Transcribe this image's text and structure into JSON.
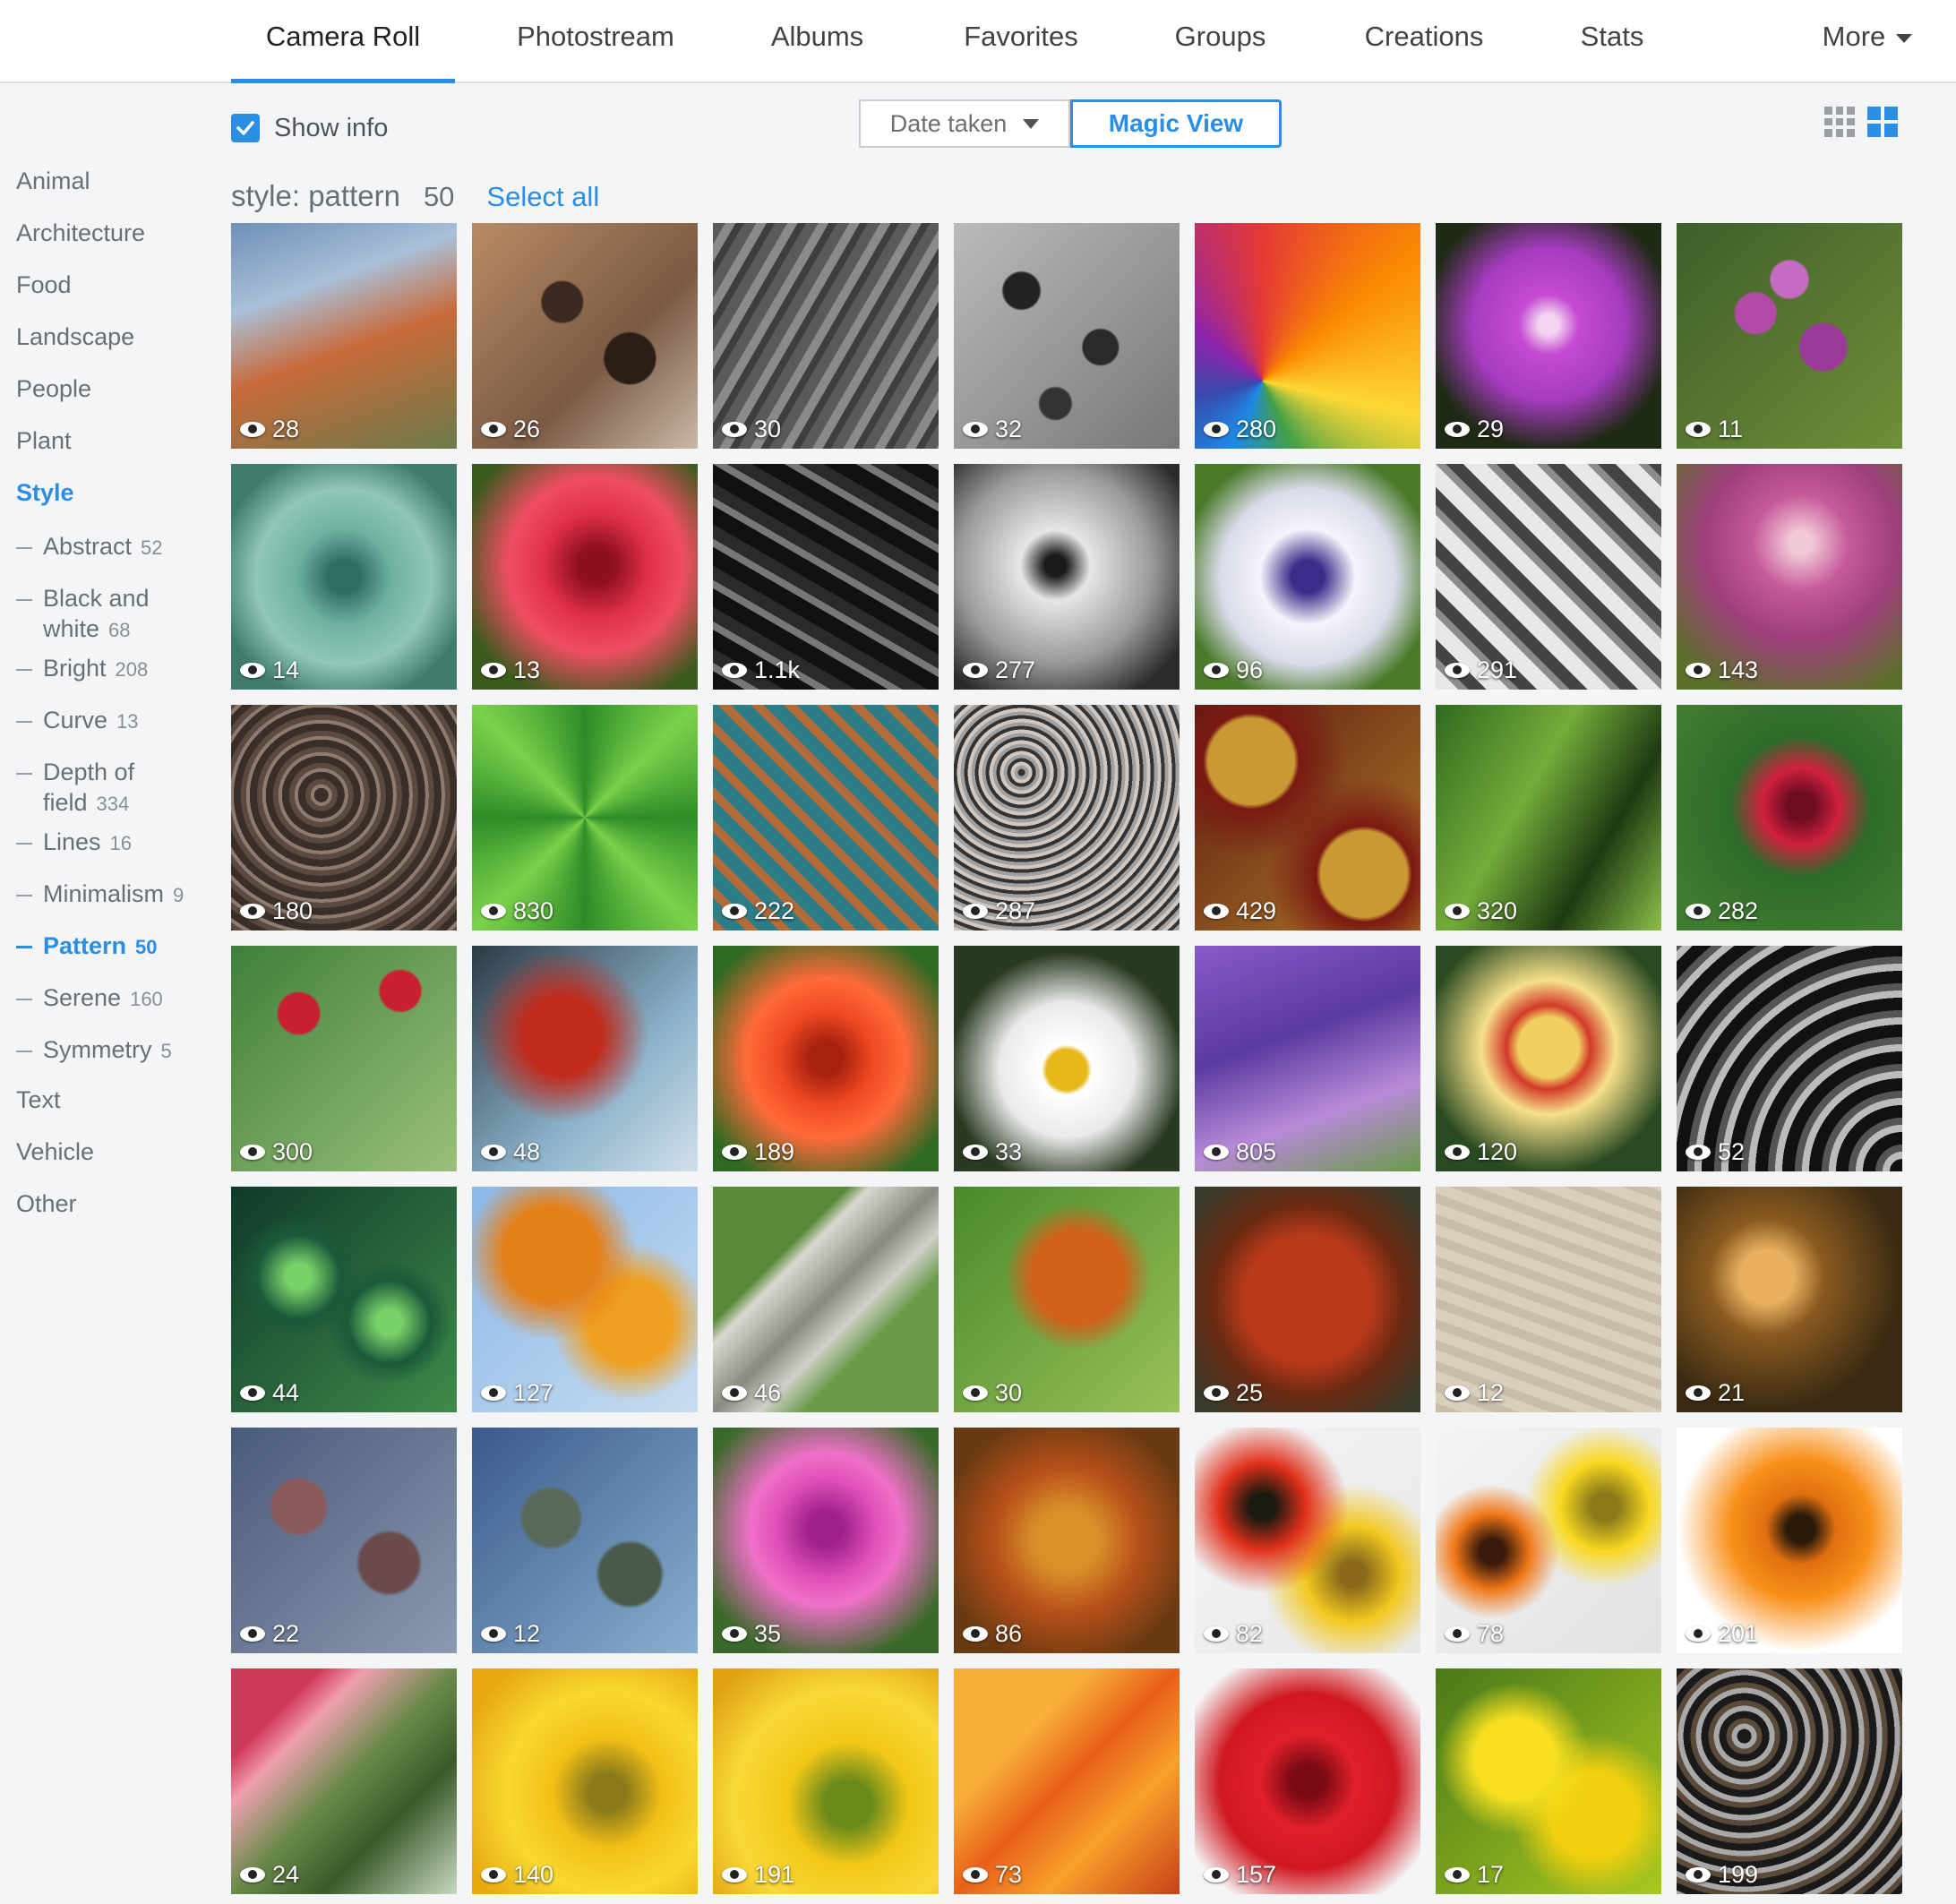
{
  "nav": {
    "tabs": [
      {
        "label": "Camera Roll",
        "active": true
      },
      {
        "label": "Photostream"
      },
      {
        "label": "Albums"
      },
      {
        "label": "Favorites"
      },
      {
        "label": "Groups"
      },
      {
        "label": "Creations"
      },
      {
        "label": "Stats"
      },
      {
        "label": "More"
      }
    ]
  },
  "toolbar": {
    "show_info_label": "Show info",
    "show_info_checked": true,
    "sort_label": "Date taken",
    "magic_view_label": "Magic View"
  },
  "sidebar": {
    "categories": [
      "Animal",
      "Architecture",
      "Food",
      "Landscape",
      "People",
      "Plant",
      "Style"
    ],
    "style_subs": [
      {
        "label": "Abstract",
        "count": "52"
      },
      {
        "label": "Black and",
        "label2": "white",
        "count": "68"
      },
      {
        "label": "Bright",
        "count": "208"
      },
      {
        "label": "Curve",
        "count": "13"
      },
      {
        "label": "Depth of",
        "label2": "field",
        "count": "334"
      },
      {
        "label": "Lines",
        "count": "16"
      },
      {
        "label": "Minimalism",
        "count": "9"
      },
      {
        "label": "Pattern",
        "count": "50",
        "active": true
      },
      {
        "label": "Serene",
        "count": "160"
      },
      {
        "label": "Symmetry",
        "count": "5"
      }
    ],
    "trailing": [
      "Text",
      "Vehicle",
      "Other"
    ]
  },
  "heading": {
    "label": "style: pattern",
    "count": "50",
    "select_all": "Select all"
  },
  "colors": {
    "accent": "#2b8de3",
    "nav_bg": "#ffffff",
    "page_bg": "#f3f5f6"
  },
  "photos": [
    {
      "views": "28",
      "subject": "aloe flowers",
      "bg": "linear-gradient(160deg,#6f8fb8 0%,#a9c0d8 30%,#c86a3a 55%,#6c7a4a 100%)"
    },
    {
      "views": "26",
      "subject": "honeycomb rock",
      "bg": "radial-gradient(circle at 40% 35%,#3a2a20 0 10%,transparent 11%),radial-gradient(circle at 70% 60%,#2a1e16 0 12%,transparent 13%),linear-gradient(135deg,#b98b65,#7a5a44 60%,#c9b8a6)"
    },
    {
      "views": "30",
      "subject": "lava rock grey",
      "bg": "repeating-linear-gradient(120deg,#5a5a5a 0 12px,#8a8a8a 12px 22px,#3e3e3e 22px 30px)"
    },
    {
      "views": "32",
      "subject": "porous surface",
      "bg": "radial-gradient(circle at 30% 30%,#222 0 8%,transparent 9%),radial-gradient(circle at 65% 55%,#2a2a2a 0 9%,transparent 10%),radial-gradient(circle at 45% 80%,#333 0 7%,transparent 8%),linear-gradient(135deg,#bbb,#777)"
    },
    {
      "views": "280",
      "subject": "hot air balloon",
      "bg": "conic-gradient(from 0deg at 30% 70%,#e53935,#fb8c00,#fdd835,#43a047,#1e88e5,#3949ab,#8e24aa,#e53935)"
    },
    {
      "views": "29",
      "subject": "purple geranium",
      "bg": "radial-gradient(circle at 50% 45%,#f3d3f0 0 6%,#c44bd2 18%,#a63cc0 45%,#1f2a14 75%)"
    },
    {
      "views": "11",
      "subject": "verbena purple",
      "bg": "radial-gradient(circle at 35% 40%,#b24aa8 0 10%,transparent 11%),radial-gradient(circle at 65% 55%,#9c3a99 0 12%,transparent 13%),radial-gradient(circle at 50% 25%,#c46cc2 0 9%,transparent 10%),linear-gradient(135deg,#3f5e2a,#6f8f3a)"
    },
    {
      "views": "14",
      "subject": "succulent",
      "bg": "radial-gradient(circle at 50% 50%,#2f6f63 0 10%,#6fb2a2 30%,#8fc7b8 55%,#3f7b6c 80%)"
    },
    {
      "views": "13",
      "subject": "red rose",
      "bg": "radial-gradient(circle at 55% 45%,#8e0f1e 0 10%,#e0304a 30%,#ef4e62 50%,#3b5a1e 80%)"
    },
    {
      "views": "1.1k",
      "subject": "bw pavement shadows",
      "bg": "repeating-linear-gradient(30deg,#111 0 18px,#777 18px 26px,#2a2a2a 26px 40px)"
    },
    {
      "views": "277",
      "subject": "bw lily stamens",
      "bg": "radial-gradient(circle at 45% 45%,#1a1a1a 0 6%,#e6e6e6 20%,#9a9a9a 55%,#2a2a2a 85%)"
    },
    {
      "views": "96",
      "subject": "white violet",
      "bg": "radial-gradient(circle at 50% 50%,#3b2d8a 0 10%,#f4f4fb 30%,#d9dbe8 55%,#4a7a2a 80%)"
    },
    {
      "views": "291",
      "subject": "bw architecture",
      "bg": "repeating-linear-gradient(45deg,#e8e8e8 0 18px,#8c8c8c 18px 26px,#444 26px 40px)"
    },
    {
      "views": "143",
      "subject": "hellebore pink",
      "bg": "radial-gradient(circle at 55% 35%,#f2c7d6 0 6%,#c55a9a 25%,#9e3f7c 50%,#5c6f2a 85%)"
    },
    {
      "views": "180",
      "subject": "tree rings stone",
      "bg": "repeating-radial-gradient(circle at 40% 40%,#3a2f28 0 8px,#8d7b6f 8px 12px,#5a4a40 12px 18px)"
    },
    {
      "views": "830",
      "subject": "green leaf veins",
      "bg": "conic-gradient(from 0deg at 50% 50%,#2e8b28,#7bd14a,#2e8b28,#7bd14a,#2e8b28,#7bd14a,#2e8b28,#7bd14a,#2e8b28)"
    },
    {
      "views": "222",
      "subject": "ornate ceiling",
      "bg": "repeating-linear-gradient(45deg,#b46b3a 0 10px,#2d7d86 10px 26px),repeating-linear-gradient(-45deg,#d8a556 0 10px,transparent 10px 26px)"
    },
    {
      "views": "287",
      "subject": "ornate iron gate",
      "bg": "repeating-radial-gradient(circle at 30% 30%,#333 0 4px,#a0a0a0 4px 8px,#d0c8c0 8px 12px)"
    },
    {
      "views": "429",
      "subject": "carved golden panels",
      "bg": "radial-gradient(circle at 25% 25%,#c99934 0 18%,#7a1a12 20%,transparent 40%),radial-gradient(circle at 75% 75%,#c99934 0 18%,#7a1a12 20%,transparent 40%),linear-gradient(135deg,#5a1a10,#b27a2a)"
    },
    {
      "views": "320",
      "subject": "green leaves",
      "bg": "linear-gradient(120deg,#2f6a1f,#74ac3a 40%,#1e3a12 70%,#8cc04a)"
    },
    {
      "views": "282",
      "subject": "red bee balm",
      "bg": "radial-gradient(circle at 55% 45%,#6e0d22 0 8%,#d0203e 22%,#2e6b2a 40%,#3f7a30 80%)"
    },
    {
      "views": "300",
      "subject": "bee balm plants",
      "bg": "radial-gradient(circle at 30% 30%,#c82030 0 9%,transparent 10%),radial-gradient(circle at 75% 20%,#c82030 0 8%,transparent 9%),linear-gradient(135deg,#3f7f3a,#9bc07a)"
    },
    {
      "views": "48",
      "subject": "red autumn branches",
      "bg": "radial-gradient(circle at 40% 40%,#c22a1a 0 20%,transparent 45%),linear-gradient(135deg,#2c3a44,#8ab0c8 60%,#d0e0ea)"
    },
    {
      "views": "189",
      "subject": "orange rose",
      "bg": "radial-gradient(circle at 50% 50%,#a8210f 0 10%,#f04a22 30%,#ff6a3a 50%,#2f6a22 85%)"
    },
    {
      "views": "33",
      "subject": "daisy",
      "bg": "radial-gradient(circle at 50% 55%,#e6b81a 0 12%,#ffffff 15%,#eaeaea 40%,#2a3a22 70%)"
    },
    {
      "views": "805",
      "subject": "lavender bee",
      "bg": "linear-gradient(160deg,#8a5ac8,#5a3aa0 40%,#b88ad8 70%,#6a9a4a)"
    },
    {
      "views": "120",
      "subject": "striped carnation",
      "bg": "radial-gradient(circle at 50% 45%,#f0d060 0 18%,#d23a2a 25%,#f6e08a 40%,#2a4a22 75%)"
    },
    {
      "views": "52",
      "subject": "spiral architecture",
      "bg": "repeating-radial-gradient(circle at 100% 100%,#111 0 14px,#bbb 14px 22px,#555 22px 30px)"
    },
    {
      "views": "44",
      "subject": "patterned leaves",
      "bg": "radial-gradient(circle at 30% 40%,#7ad16a 0 6%,#1a5a3a 20%,transparent 30%),radial-gradient(circle at 70% 60%,#7ad16a 0 6%,#1a5a3a 20%,transparent 30%),linear-gradient(135deg,#0f3a2a,#3f8a4a)"
    },
    {
      "views": "127",
      "subject": "orange autumn leaves sky",
      "bg": "radial-gradient(circle at 35% 30%,#e4801a 0 22%,transparent 40%),radial-gradient(circle at 70% 60%,#f0a020 0 20%,transparent 38%),linear-gradient(135deg,#8ab8e8,#c8dcf0)"
    },
    {
      "views": "46",
      "subject": "birch trunk",
      "bg": "linear-gradient(135deg,#5a8a3a 0 30%,#d8d8d0 35%,#8a8a80 50%,#d0d0c8 60%,#6a9a4a 70%)"
    },
    {
      "views": "30",
      "subject": "maple leaf on grass",
      "bg": "radial-gradient(circle at 55% 40%,#d0601a 0 25%,transparent 40%),linear-gradient(135deg,#4a8a2a,#9ac05a)"
    },
    {
      "views": "25",
      "subject": "red maple leaf",
      "bg": "radial-gradient(circle at 50% 50%,#b83a1a 0 40%,#6a2a12 60%,#3a3a2a 90%)"
    },
    {
      "views": "12",
      "subject": "sand dunes",
      "bg": "repeating-linear-gradient(20deg,#c8bda8 0 10px,#d8cfbc 10px 22px)"
    },
    {
      "views": "21",
      "subject": "cactus fingers",
      "bg": "radial-gradient(circle at 40% 40%,#e8b060 0 14%,#8a5a20 30%,#3a2a12 70%)"
    },
    {
      "views": "22",
      "subject": "spiny cacti pink",
      "bg": "radial-gradient(circle at 30% 35%,#8a5a5a 0 12%,transparent 14%),radial-gradient(circle at 70% 60%,#6a4a4a 0 14%,transparent 16%),linear-gradient(135deg,#4a5a7a,#8a9ab0)"
    },
    {
      "views": "12",
      "subject": "spiny cacti blue",
      "bg": "radial-gradient(circle at 35% 40%,#5a6a5a 0 14%,transparent 16%),radial-gradient(circle at 70% 65%,#4a5a4a 0 14%,transparent 16%),linear-gradient(135deg,#3a5a8a,#8ab0d0)"
    },
    {
      "views": "35",
      "subject": "pink rose",
      "bg": "radial-gradient(circle at 50% 45%,#a0208a 0 10%,#e050b8 30%,#f070c8 45%,#3a6a2a 80%)"
    },
    {
      "views": "86",
      "subject": "autumn foliage warm",
      "bg": "radial-gradient(circle at 50% 50%,#d8902a 0 20%,#b8501a 45%,#6a3a12 80%)"
    },
    {
      "views": "82",
      "subject": "red yellow gerberas",
      "bg": "radial-gradient(circle at 30% 35%,#1a1a10 0 6%,#e0301a 20%,transparent 40%),radial-gradient(circle at 70% 65%,#8a6a1a 0 6%,#f2c820 22%,transparent 42%),linear-gradient(135deg,#f4f4f4,#e8e8e8)"
    },
    {
      "views": "78",
      "subject": "orange yellow gerberas",
      "bg": "radial-gradient(circle at 25% 55%,#3a1a0a 0 6%,#f07818 18%,transparent 32%),radial-gradient(circle at 75% 35%,#8a7a1a 0 6%,#f8d820 20%,transparent 36%),linear-gradient(135deg,#f4f4f4,#e2e2e2)"
    },
    {
      "views": "201",
      "subject": "orange gerbera",
      "bg": "radial-gradient(circle at 55% 45%,#2a1a0a 0 8%,#e07010 20%,#f8901a 40%,#fff 70%)"
    },
    {
      "views": "24",
      "subject": "gerbera underside",
      "bg": "linear-gradient(135deg,#d03a5a 0 20%,#f0a0b0 30%,#6a8a4a 50%,#3a5a2a 70%,#c8d8c0)"
    },
    {
      "views": "140",
      "subject": "yellow dahlia",
      "bg": "radial-gradient(circle at 60% 55%,#8a7a1a 0 10%,#f2c018 30%,#f8d830 55%,#e8a810 85%)"
    },
    {
      "views": "191",
      "subject": "yellow gerbera",
      "bg": "radial-gradient(circle at 60% 60%,#6a8a1a 0 12%,#f2c818 32%,#f8d838 60%,#e0a010 90%)"
    },
    {
      "views": "73",
      "subject": "orange lily",
      "bg": "linear-gradient(135deg,#f8b038 0 30%,#e8601a 50%,#f8a02a 70%,#c8401a)"
    },
    {
      "views": "157",
      "subject": "red rose water drops",
      "bg": "radial-gradient(circle at 50% 50%,#7a0a14 0 10%,#e0202a 30%,#d01820 55%,#f4f4f4 85%)"
    },
    {
      "views": "17",
      "subject": "yellow lilies",
      "bg": "radial-gradient(circle at 35% 40%,#f8e020 0 20%,transparent 38%),radial-gradient(circle at 70% 65%,#f0d010 0 20%,transparent 38%),linear-gradient(135deg,#4a7a1a,#a8c820)"
    },
    {
      "views": "199",
      "subject": "hex nuts",
      "bg": "repeating-radial-gradient(circle at 30% 30%,#1a1a1a 0 8px,#a8a8a8 8px 14px,#5a4a3a 14px 20px)"
    }
  ]
}
